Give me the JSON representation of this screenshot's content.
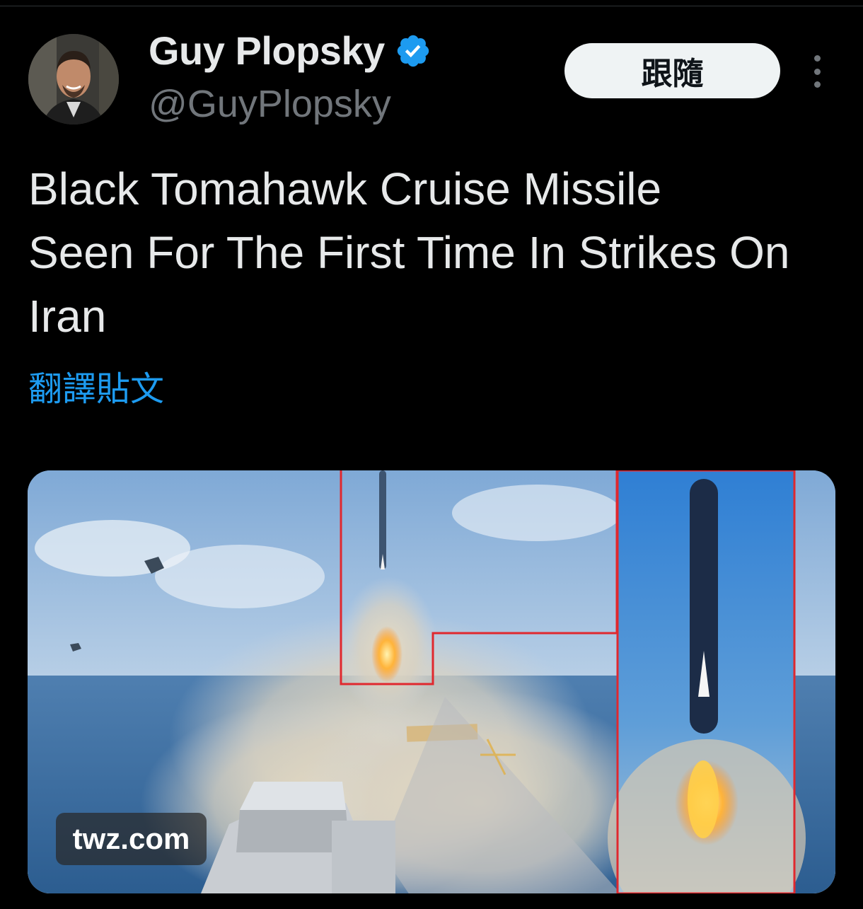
{
  "author": {
    "display_name": "Guy Plopsky",
    "handle": "@GuyPlopsky",
    "verified": true
  },
  "actions": {
    "follow_label": "跟隨",
    "more_icon": "more-vertical-icon"
  },
  "post": {
    "text": "Black Tomahawk Cruise Missile\nSeen For The First Time In Strikes On\nIran",
    "translate_label": "翻譯貼文"
  },
  "media": {
    "watermark": "twz.com"
  },
  "colors": {
    "background": "#000000",
    "link": "#1d9bf0",
    "verified": "#1d9bf0",
    "highlight_box": "#e0282e"
  }
}
